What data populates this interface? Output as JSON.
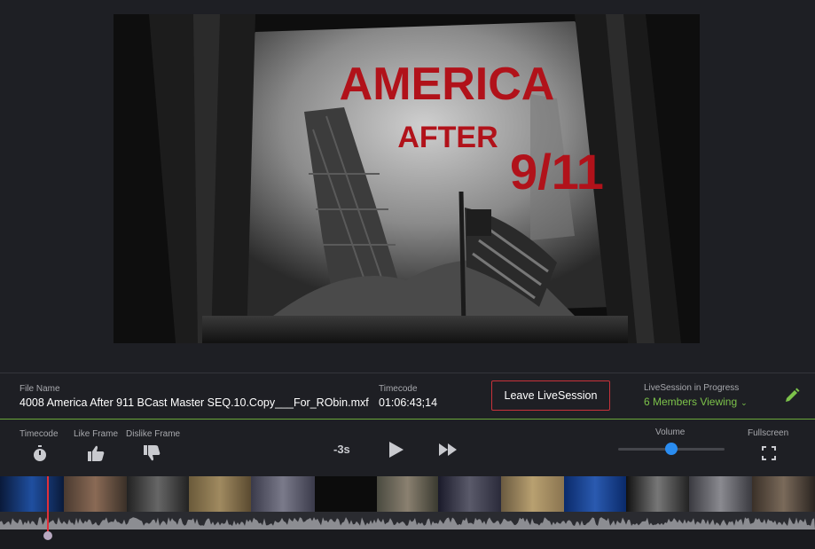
{
  "video": {
    "title_line1": "AMERICA",
    "title_line2": "AFTER",
    "title_line3": "9/11"
  },
  "info": {
    "file_name_label": "File Name",
    "file_name": "4008 America After 911 BCast Master SEQ.10.Copy___For_RObin.mxf",
    "timecode_label": "Timecode",
    "timecode": "01:06:43;14",
    "leave_button": "Leave LiveSession",
    "live_label": "LiveSession in Progress",
    "members": "6 Members Viewing"
  },
  "controls": {
    "timecode_label": "Timecode",
    "like_label": "Like Frame",
    "dislike_label": "Dislike Frame",
    "skip_back_label": "-3s",
    "volume_label": "Volume",
    "volume_level": 0.5,
    "fullscreen_label": "Fullscreen"
  },
  "icons": {
    "timecode": "stopwatch-icon",
    "like": "thumbs-up-icon",
    "dislike": "thumbs-down-icon",
    "play": "play-icon",
    "fast_forward": "fast-forward-icon",
    "fullscreen": "fullscreen-icon",
    "edit": "pencil-icon"
  },
  "colors": {
    "accent_green": "#7cc24a",
    "leave_border": "#c8323a",
    "volume_knob": "#2a8cf0",
    "playhead": "#e0303a"
  }
}
